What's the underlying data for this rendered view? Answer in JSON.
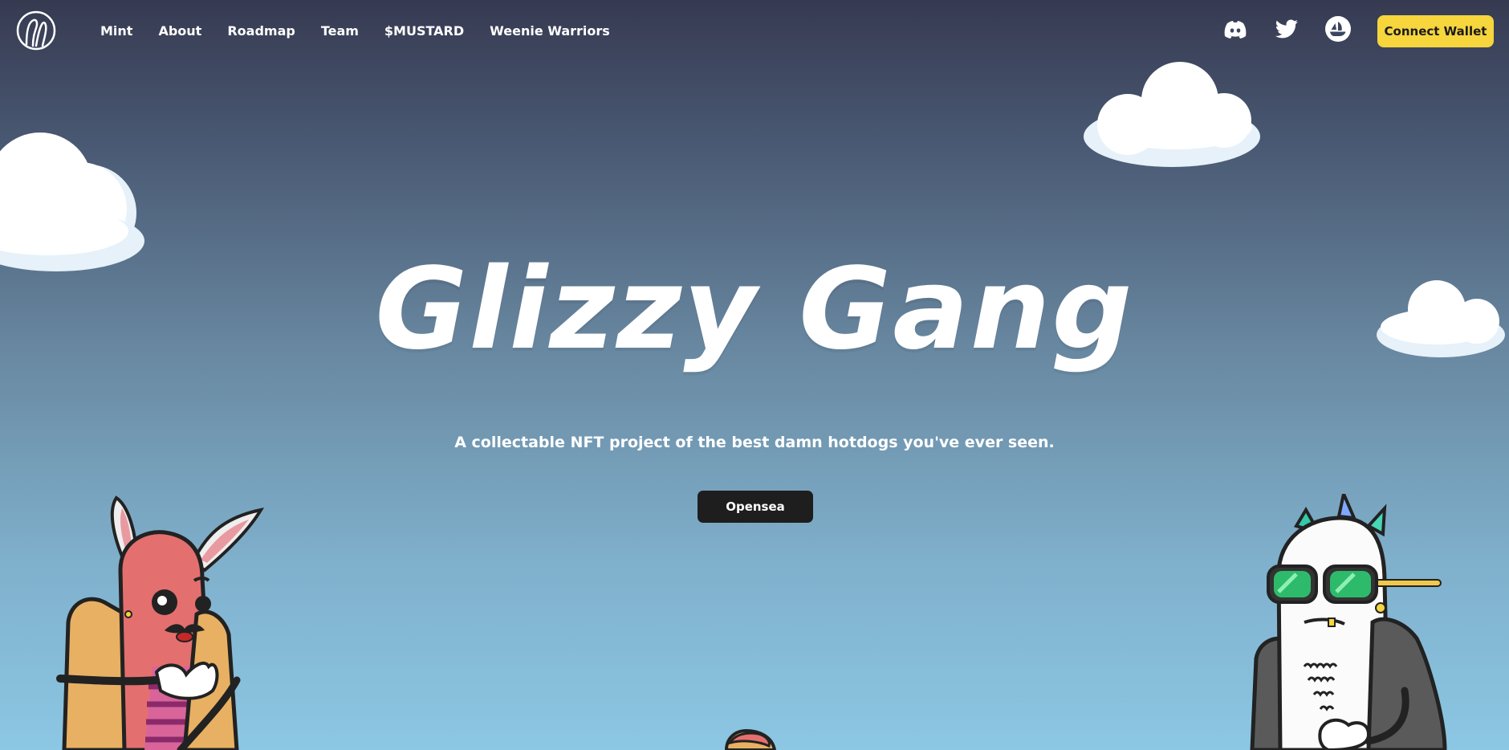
{
  "nav": {
    "links": [
      "Mint",
      "About",
      "Roadmap",
      "Team",
      "$MUSTARD",
      "Weenie Warriors"
    ],
    "socials": [
      "discord-icon",
      "twitter-icon",
      "opensea-icon"
    ],
    "connect_wallet": "Connect Wallet"
  },
  "hero": {
    "title": "Glizzy Gang",
    "tagline": "A collectable NFT project of the best damn hotdogs you've ever seen.",
    "button": "Opensea"
  },
  "colors": {
    "accent": "#f6d53d",
    "button_dark": "#1e1e1e",
    "sky_top": "#363a51",
    "sky_bottom": "#8cc7e3"
  }
}
